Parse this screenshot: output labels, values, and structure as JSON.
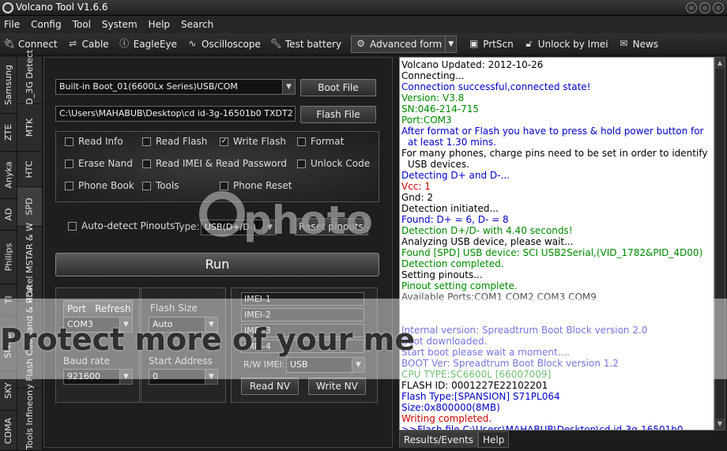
{
  "window": {
    "title": "Volcano Tool V1.6.6"
  },
  "menu": [
    "File",
    "Config",
    "Tool",
    "System",
    "Help",
    "Search"
  ],
  "toolbar": {
    "connect": "Connect",
    "cable": "Cable",
    "eagleeye": "EagleEye",
    "oscilloscope": "Oscilloscope",
    "test_battery": "Test battery",
    "advanced_form": "Advanced form",
    "prtscn": "PrtScn",
    "unlock_imei": "Unlock by Imei",
    "news": "News"
  },
  "left_tabs_outer": [
    "Samsung",
    "ZTE",
    "Anyka",
    "AD",
    "Philips",
    "TI",
    "SI4904",
    "SKY",
    "CDMA"
  ],
  "left_tabs_inner": [
    "AD_3G Detect",
    "MTK",
    "HTC",
    "SPD",
    "Alcatel MSTAR & W",
    "Easy Flash Coolsand & RDA",
    "Tools Infineon"
  ],
  "spd": {
    "boot_select": "Built-in Boot_01(6600Lx Series)USB/COM",
    "boot_file_btn": "Boot File",
    "flash_path": "C:\\Users\\MAHABUB\\Desktop\\cd id-3g-16501b0  TXDT2",
    "flash_file_btn": "Flash File",
    "options": {
      "read_info": "Read Info",
      "read_flash": "Read Flash",
      "write_flash": "Write Flash",
      "format": "Format",
      "erase_nand": "Erase Nand",
      "read_imei_pw": "Read IMEI & Read Password",
      "unlock_code": "Unlock Code",
      "phone_book": "Phone Book",
      "tools": "Tools",
      "phone_reset": "Phone Reset"
    },
    "auto_detect": "Auto-detect Pinouts",
    "type_label": "Type:",
    "type_value": "USB(D+/D-)",
    "reset_pinouts": "Reset pinouts",
    "run": "Run",
    "port_label": "Port",
    "refresh_label": "Refresh",
    "port_value": "COM3",
    "flash_size_label": "Flash Size",
    "flash_size_value": "Auto",
    "baud_label": "Baud rate",
    "baud_value": "921600",
    "start_addr_label": "Start Address",
    "start_addr_value": "0",
    "imei": [
      "IMEI-1",
      "IMEI-2",
      "IMEI-3",
      "IMEI-4"
    ],
    "rw_imei_label": "R/W IMEI:",
    "rw_imei_value": "USB",
    "read_nv": "Read NV",
    "write_nv": "Write NV"
  },
  "log": [
    {
      "text": "Volcano Updated: 2012-10-26",
      "color": "#000000"
    },
    {
      "text": "Connecting...",
      "color": "#000000"
    },
    {
      "text": "Connection successful,connected state!",
      "color": "#0000cc"
    },
    {
      "text": "Version: V3.8",
      "color": "#008800"
    },
    {
      "text": "SN:046-214-715",
      "color": "#008800"
    },
    {
      "text": "Port:COM3",
      "color": "#008800"
    },
    {
      "text": "After format or Flash you have to press & hold power button for at least 1.30 mins.",
      "color": "#0000cc"
    },
    {
      "text": "For many phones, charge pins need to be set in order to identify USB devices.",
      "color": "#000000"
    },
    {
      "text": "Detecting D+ and D-...",
      "color": "#0000cc"
    },
    {
      "text": "Vcc: 1",
      "color": "#cc0000"
    },
    {
      "text": "Gnd: 2",
      "color": "#000000"
    },
    {
      "text": "Detection initiated...",
      "color": "#000000"
    },
    {
      "text": "Found:  D+ = 6, D- = 8",
      "color": "#0000cc"
    },
    {
      "text": "Detection D+/D- with 4.40 seconds!",
      "color": "#008800"
    },
    {
      "text": "Analyzing USB device, please wait...",
      "color": "#000000"
    },
    {
      "text": "Found [SPD] USB device: SCI USB2Serial,(VID_1782&PID_4D00)",
      "color": "#008800"
    },
    {
      "text": "Detection completed.",
      "color": "#008800"
    },
    {
      "text": "Setting pinouts...",
      "color": "#000000"
    },
    {
      "text": "Pinout setting complete.",
      "color": "#008800"
    },
    {
      "text": "Available Ports:COM1 COM2 COM3 COM9",
      "color": "#555555"
    },
    {
      "text": "",
      "color": "#000000"
    },
    {
      "text": "",
      "color": "#000000"
    },
    {
      "text": "Internal version: Spreadtrum Boot Block version 2.0",
      "color": "#0000cc"
    },
    {
      "text": "Boot downloaded.",
      "color": "#0000cc"
    },
    {
      "text": "Start boot please wait a moment....",
      "color": "#0000cc"
    },
    {
      "text": "BOOT Ver: Spreadtrum Boot Block version 1.2",
      "color": "#0000cc"
    },
    {
      "text": "CPU TYPE:SC6600L [66007009]",
      "color": "#008800"
    },
    {
      "text": "FLASH ID: 0001227E22102201",
      "color": "#000000"
    },
    {
      "text": "Flash Type:[SPANSION] S71PL064",
      "color": "#0000cc"
    },
    {
      "text": "Size:0x800000(8MB)",
      "color": "#0000cc"
    },
    {
      "text": "Writing completed.",
      "color": "#cc0000"
    },
    {
      "text": ">>Flash file C:\\Users\\MAHABUB\\Desktop\\cd id-3g-16501b0",
      "color": "#0000cc"
    }
  ],
  "bottom_tabs": [
    "Results/Events",
    "Help"
  ],
  "watermark": {
    "brand": "photo",
    "banner": "Protect more of your me"
  }
}
